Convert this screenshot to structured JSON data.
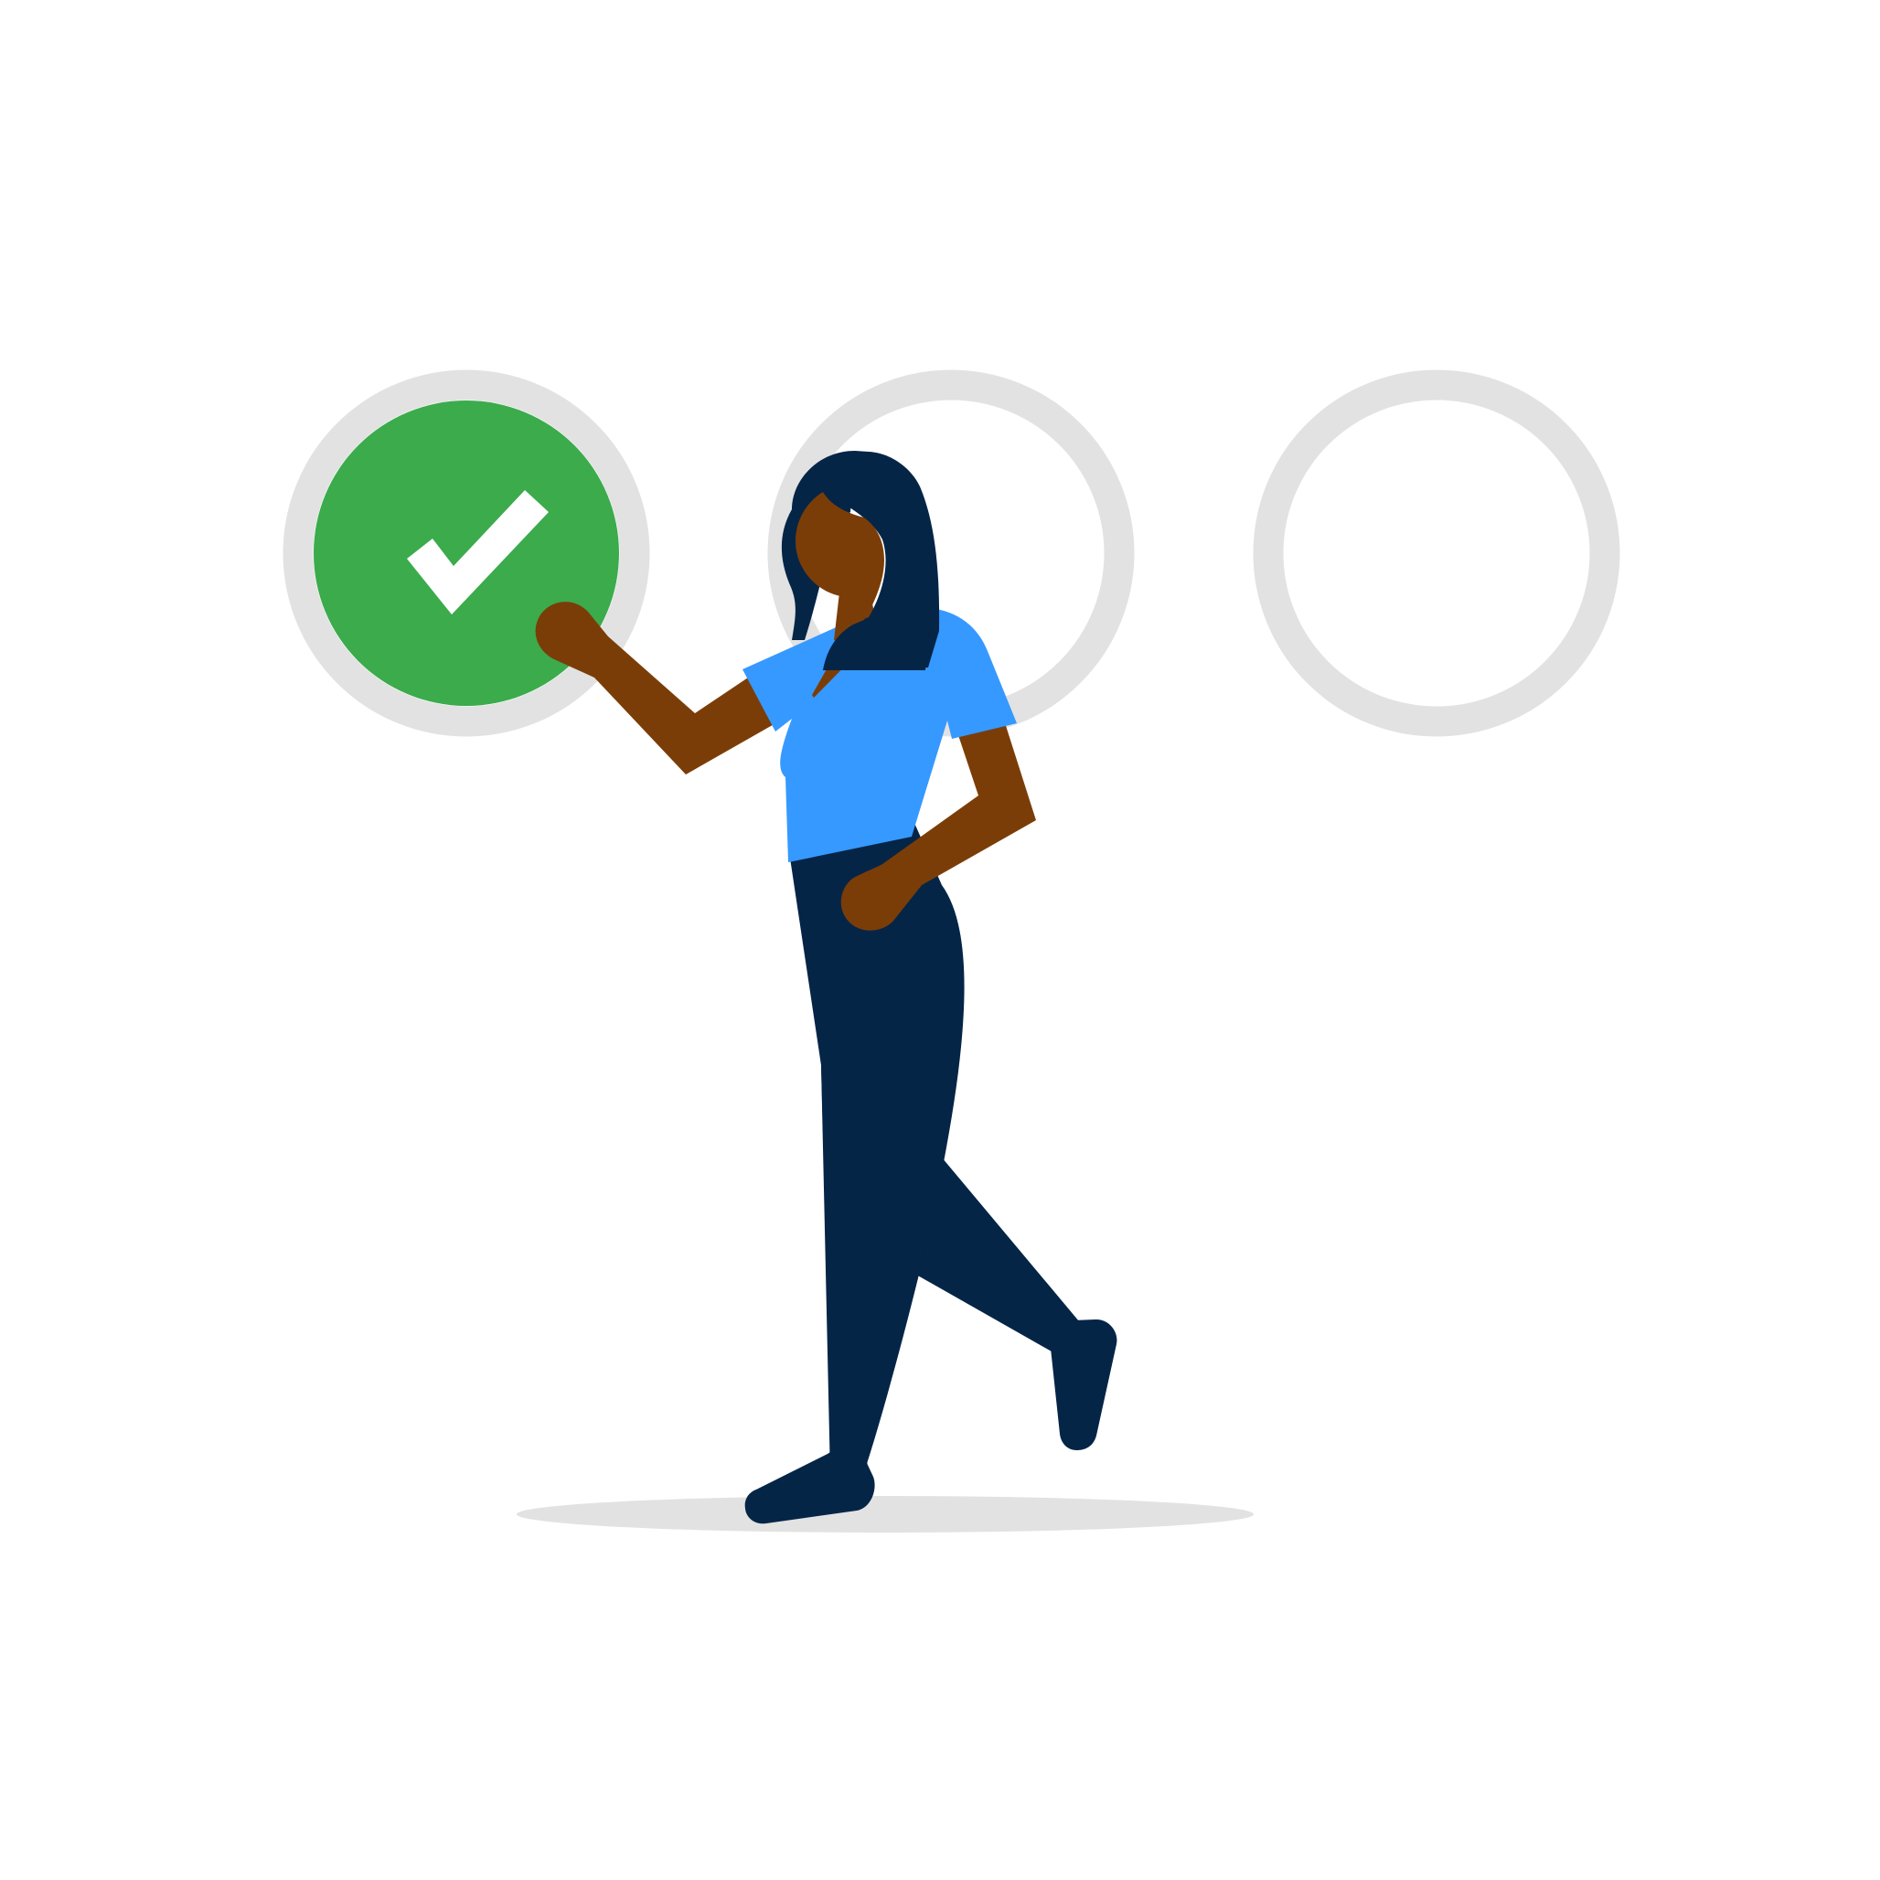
{
  "steps": [
    {
      "status": "complete",
      "icon": "checkmark-icon"
    },
    {
      "status": "incomplete",
      "icon": ""
    },
    {
      "status": "incomplete",
      "icon": ""
    }
  ],
  "colors": {
    "background": "#ffffff",
    "ring": "#e2e2e2",
    "complete_fill": "#3bab4c",
    "checkmark": "#ffffff",
    "skin": "#7b3d07",
    "hair_and_pants": "#052547",
    "shirt": "#3699ff",
    "shadow": "#e2e2e2"
  },
  "figure": {
    "description_icon": "walking-woman-illustration"
  }
}
